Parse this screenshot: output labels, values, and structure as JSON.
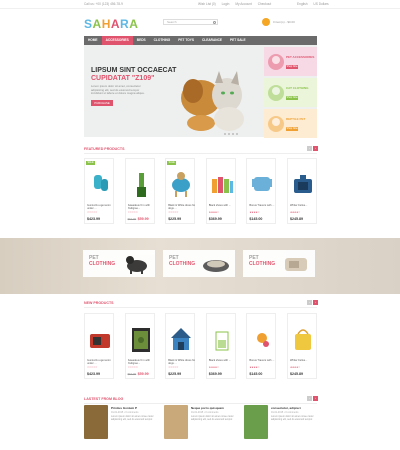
{
  "topbar": {
    "left": "Call us: +00 (123) 456-78-9",
    "links": [
      "Wish List (0)",
      "Login",
      "My Account",
      "Checkout"
    ],
    "lang": "English",
    "currency": "US Dollars"
  },
  "logo": {
    "text": "SAHARA",
    "letters": [
      "S",
      "A",
      "H",
      "A",
      "R",
      "A"
    ],
    "colors": [
      "#5cb8e5",
      "#8bc34a",
      "#f0a030",
      "#e0536d",
      "#5cb8e5",
      "#8bc34a"
    ]
  },
  "search": {
    "placeholder": "Search"
  },
  "cart": {
    "label": "0 item(s) - $0.00"
  },
  "nav": {
    "items": [
      "HOME",
      "ACCESSORIES",
      "BEDS",
      "CLOTHING",
      "PET TOYS",
      "CLEARANCE",
      "PET SALE"
    ],
    "active_index": 1
  },
  "hero": {
    "title1": "LIPSUM SINT OCCAECAT",
    "title2": "CUPIDATAT \"Z109\"",
    "text": "Lorem ipsum dolor sit amet, consectetur adipisicing elit, sed do eiusmod tempor incididunt ut labore et dolore magna aliqua.",
    "button": "PURCHASE",
    "dots": 4
  },
  "side_banners": [
    {
      "title": "PET ACCESSORIES",
      "link": "Shop Now",
      "color": "#e0536d",
      "bg": "#f7d9e6"
    },
    {
      "title": "CAT CLOTHING",
      "link": "Shop Now",
      "color": "#8bc34a",
      "bg": "#eaf5da"
    },
    {
      "title": "REPTILE PET",
      "link": "Shop Now",
      "color": "#f0a030",
      "bg": "#fdecd2"
    }
  ],
  "featured": {
    "title": "FEATURED PRODUCTS",
    "products": [
      {
        "name": "Gumiuzzu eget enim under ...",
        "stars": "☆☆☆☆☆",
        "price": "$423.99",
        "badge": "SALE",
        "img": "gloves"
      },
      {
        "name": "Sawadeus 6 in with Pedigree...",
        "stars": "☆☆☆☆☆",
        "old": "$62.00",
        "price": "$59.99",
        "img": "brush"
      },
      {
        "name": "Black & White dress for dogs ...",
        "stars": "☆☆☆☆☆",
        "price": "$225.99",
        "badge": "SALE",
        "img": "dogcoat"
      },
      {
        "name": "Black shoes with ...",
        "stars": "★★★★☆",
        "price": "$369.99",
        "img": "bottles"
      },
      {
        "name": "Bonus Travers with ...",
        "stars": "★★★★☆",
        "price": "$145.00",
        "img": "sweater"
      },
      {
        "name": "Whiter Felixe...",
        "stars": "★★★★☆",
        "price": "$245.89",
        "img": "carrier"
      }
    ]
  },
  "pet_cards": [
    {
      "line1": "PET",
      "line2": "CLOTHING"
    },
    {
      "line1": "PET",
      "line2": "CLOTHING"
    },
    {
      "line1": "PET",
      "line2": "CLOTHING"
    }
  ],
  "new_products": {
    "title": "NEW PRODUCTS",
    "products": [
      {
        "name": "Gumiuzzu eget enim under ...",
        "stars": "☆☆☆☆☆",
        "price": "$423.99",
        "img": "carrier2"
      },
      {
        "name": "Sawadeus 6 in with Pedigree...",
        "stars": "☆☆☆☆☆",
        "old": "$62.00",
        "price": "$59.99",
        "img": "terrarium"
      },
      {
        "name": "Black & White dress for dogs ...",
        "stars": "☆☆☆☆☆",
        "price": "$225.99",
        "img": "doghouse"
      },
      {
        "name": "Black shoes with ...",
        "stars": "★★★★☆",
        "price": "$369.99",
        "img": "cage"
      },
      {
        "name": "Bonus Travers with ...",
        "stars": "★★★★☆",
        "price": "$145.00",
        "img": "ball"
      },
      {
        "name": "Whiter Felixe...",
        "stars": "★★★★☆",
        "price": "$245.89",
        "img": "bag"
      }
    ]
  },
  "blog": {
    "title": "LASTEST FROM BLOG",
    "posts": [
      {
        "title": "Pristius Gonium P",
        "meta": "01-01-2015 • 0 comments",
        "text": "Lorem ipsum dolor sit amet conse ctetur adipisicing elit, sed do eiusmod tempor."
      },
      {
        "title": "Neque porro quisquam",
        "meta": "01-01-2015 • 0 comments",
        "text": "Lorem ipsum dolor sit amet conse ctetur adipisicing elit, sed do eiusmod tempor."
      },
      {
        "title": "consectetur, adipisci",
        "meta": "01-01-2015 • 0 comments",
        "text": "Lorem ipsum dolor sit amet conse ctetur adipisicing elit, sed do eiusmod tempor."
      }
    ]
  }
}
